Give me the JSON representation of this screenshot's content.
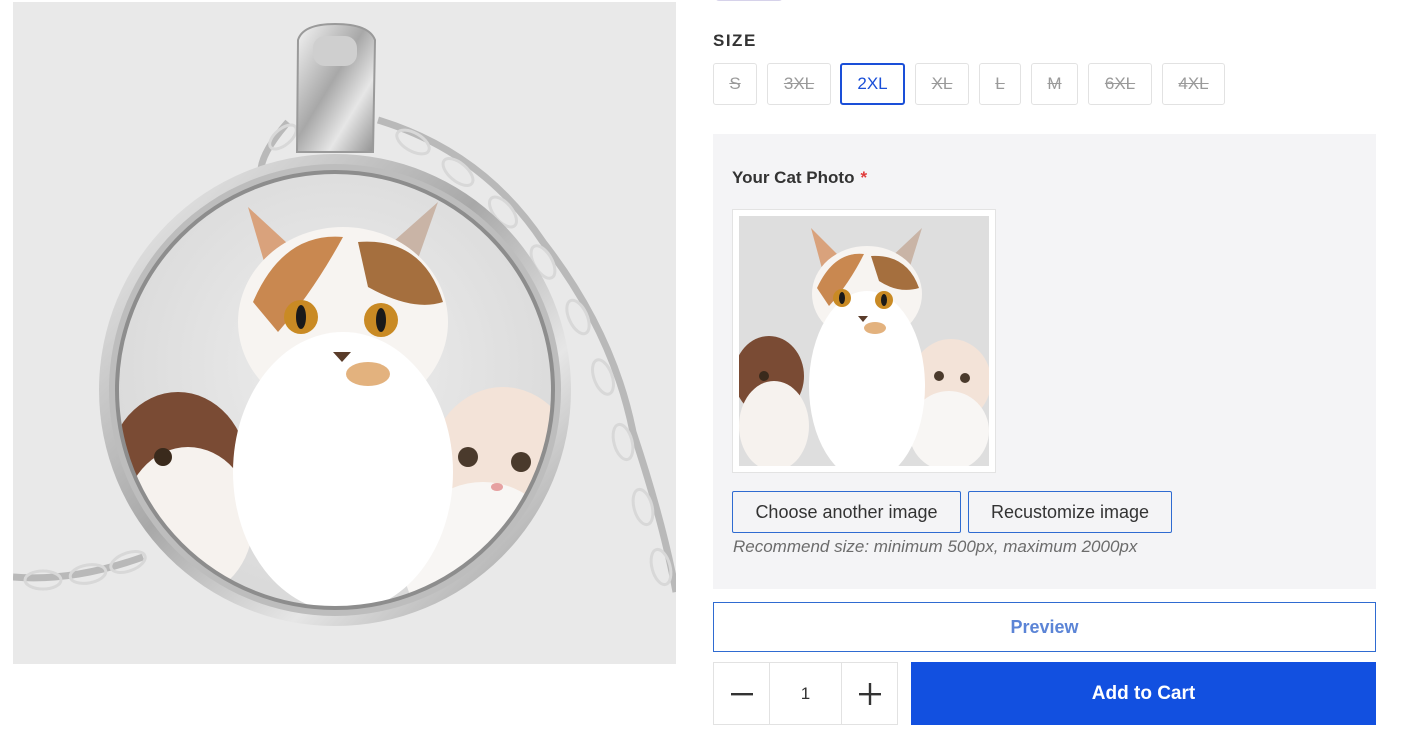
{
  "product": {
    "image_alt": "Cat photo pendant necklace"
  },
  "size": {
    "title": "SIZE",
    "options": [
      {
        "label": "S",
        "available": false,
        "selected": false
      },
      {
        "label": "3XL",
        "available": false,
        "selected": false
      },
      {
        "label": "2XL",
        "available": true,
        "selected": true
      },
      {
        "label": "XL",
        "available": false,
        "selected": false
      },
      {
        "label": "L",
        "available": false,
        "selected": false
      },
      {
        "label": "M",
        "available": false,
        "selected": false
      },
      {
        "label": "6XL",
        "available": false,
        "selected": false
      },
      {
        "label": "4XL",
        "available": false,
        "selected": false
      }
    ]
  },
  "customization": {
    "field_label": "Your Cat Photo",
    "required_mark": "*",
    "choose_another_label": "Choose another image",
    "recustomize_label": "Recustomize image",
    "hint": "Recommend size: minimum 500px, maximum 2000px"
  },
  "actions": {
    "preview_label": "Preview",
    "quantity": "1",
    "add_to_cart_label": "Add to Cart"
  },
  "colors": {
    "accent": "#1250e0",
    "selected_border": "#1a4fd8",
    "panel_bg": "#f4f4f6",
    "required": "#e03b3b"
  },
  "icons": {
    "decrement": "minus-icon",
    "increment": "plus-icon"
  }
}
